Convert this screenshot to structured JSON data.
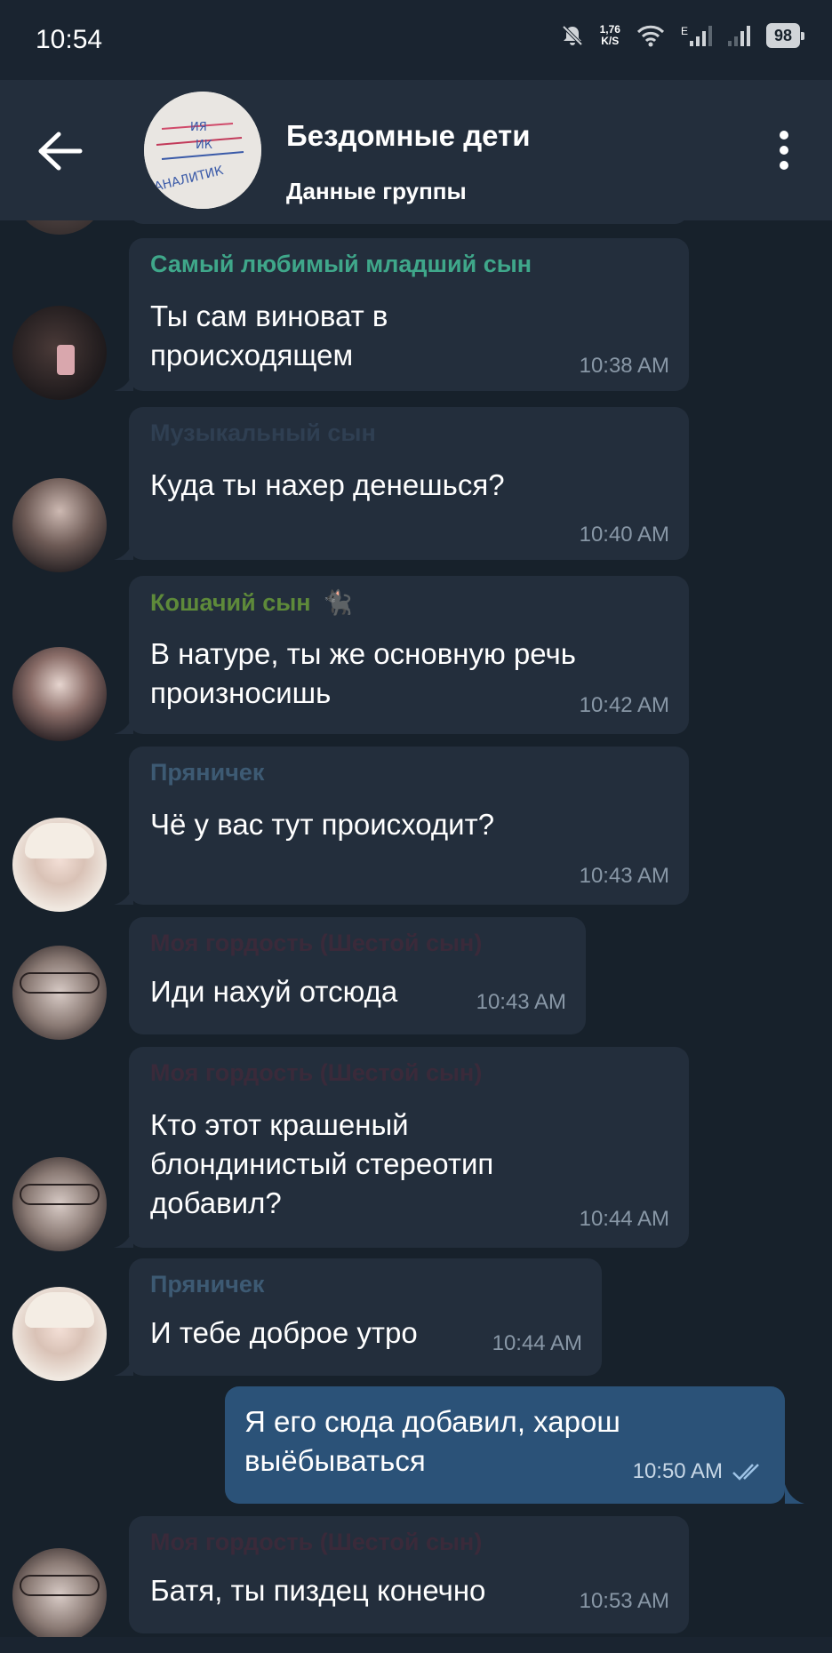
{
  "status_bar": {
    "time": "10:54",
    "speed_value": "1,76",
    "speed_unit": "K/S",
    "network_type": "E",
    "battery": "98",
    "icons": [
      "mute-icon",
      "wifi-icon",
      "signal-icon",
      "battery-icon"
    ]
  },
  "header": {
    "title": "Бездомные дети",
    "subtitle": "Данные группы",
    "avatar_text_1": "ИЯ",
    "avatar_text_2": "ИК",
    "avatar_text_3": "АНАЛИТИК"
  },
  "messages": [
    {
      "sender": "Самый любимый младший сын",
      "sender_color": "#3fa78a",
      "text": "Ты сам виноват в происходящем",
      "time": "10:38 AM"
    },
    {
      "sender": "Музыкальный сын",
      "sender_color": "#2f3f52",
      "text": "Куда ты нахер денешься?",
      "time": "10:40 AM"
    },
    {
      "sender": "Кошачий сын",
      "sender_color": "#5e8a3a",
      "text": "В натуре, ты же основную речь произносишь",
      "time": "10:42 AM"
    },
    {
      "sender": "Пряничек",
      "sender_color": "#3d5a73",
      "text": "Чё у вас тут происходит?",
      "time": "10:43 AM"
    },
    {
      "sender": "Моя гордость (Шестой сын)",
      "sender_color": "#3a2a3a",
      "text": "Иди нахуй отсюда",
      "time": "10:43 AM"
    },
    {
      "sender": "Моя гордость (Шестой сын)",
      "sender_color": "#3a2a3a",
      "text": "Кто этот крашеный блондинистый стереотип добавил?",
      "time": "10:44 AM"
    },
    {
      "sender": "Пряничек",
      "sender_color": "#3d5a73",
      "text": "И тебе доброе утро",
      "time": "10:44 AM"
    },
    {
      "outgoing": true,
      "text": "Я его сюда добавил, харош выёбываться",
      "time": "10:50 AM",
      "status": "read"
    },
    {
      "sender": "Моя гордость (Шестой сын)",
      "sender_color": "#3a2a3a",
      "text": "Батя, ты пиздец конечно",
      "time": "10:53 AM"
    }
  ],
  "colors": {
    "background": "#17212b",
    "header": "#232e3c",
    "incoming_bubble": "#232e3c",
    "outgoing_bubble": "#2b5278"
  }
}
